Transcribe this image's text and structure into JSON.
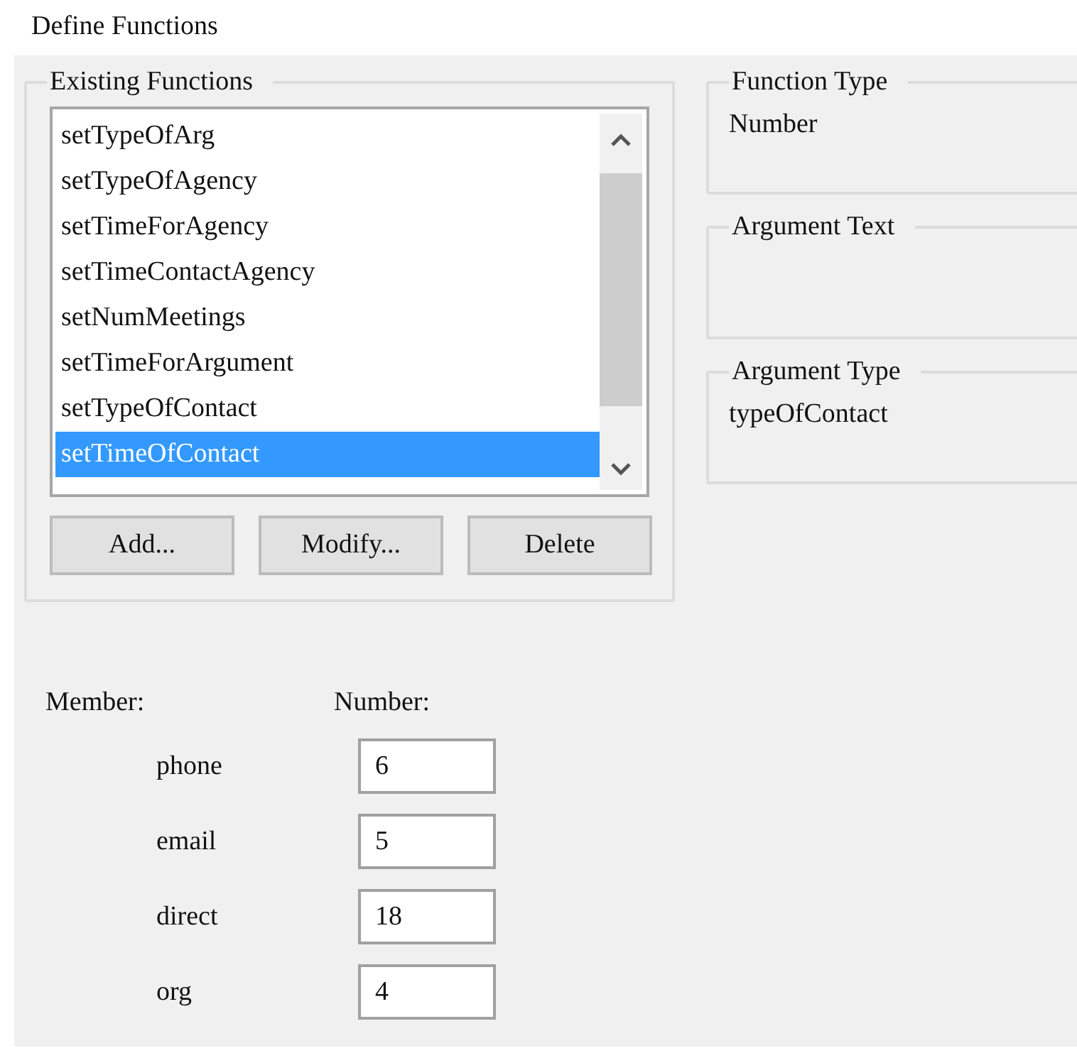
{
  "window": {
    "title": "Define Functions"
  },
  "existing_functions": {
    "title": "Existing Functions",
    "items": [
      {
        "label": "setTypeOfArg",
        "selected": false
      },
      {
        "label": "setTypeOfAgency",
        "selected": false
      },
      {
        "label": "setTimeForAgency",
        "selected": false
      },
      {
        "label": "setTimeContactAgency",
        "selected": false
      },
      {
        "label": "setNumMeetings",
        "selected": false
      },
      {
        "label": "setTimeForArgument",
        "selected": false
      },
      {
        "label": "setTypeOfContact",
        "selected": false
      },
      {
        "label": "setTimeOfContact",
        "selected": true
      }
    ],
    "buttons": [
      "Add...",
      "Modify...",
      "Delete"
    ]
  },
  "function_type": {
    "title": "Function Type",
    "value": "Number"
  },
  "argument_text": {
    "title": "Argument Text"
  },
  "argument_type": {
    "title": "Argument Type",
    "value": "typeOfContact"
  },
  "members": {
    "member_header": "Member:",
    "number_header": "Number:",
    "rows": [
      {
        "member": "phone",
        "number": "6"
      },
      {
        "member": "email",
        "number": "5"
      },
      {
        "member": "direct",
        "number": "18"
      },
      {
        "member": "org",
        "number": "4"
      }
    ]
  }
}
